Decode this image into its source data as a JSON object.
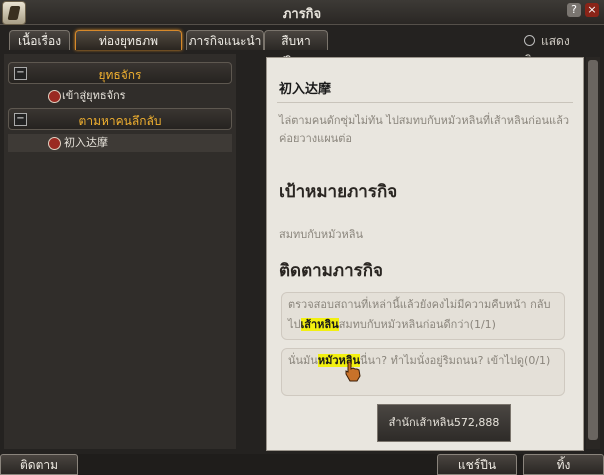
{
  "window": {
    "title": "ภารกิจ"
  },
  "tabs": [
    {
      "label": "เนื้อเรื่อง"
    },
    {
      "label": "ท่องยุทธภพ"
    },
    {
      "label": "ภารกิจแนะนำ"
    },
    {
      "label": "สืบหาปริศนา"
    }
  ],
  "show_toggle": {
    "label": "แสดงติดตาม"
  },
  "quest_list": {
    "groups": [
      {
        "label": "ยุทธจักร",
        "items": [
          "เข้าสู่ยุทธจักร"
        ]
      },
      {
        "label": "ตามหาคนลึกลับ",
        "items": [
          "初入达摩"
        ]
      }
    ]
  },
  "detail": {
    "quest_title": "初入达摩",
    "description": "ไล่ตามคนดักซุ่มไม่ทัน ไปสมทบกับหมัวหลินที่เส้าหลินก่อนแล้วค่อยวางแผนต่อ",
    "goal_heading": "เป้าหมายภารกิจ",
    "goal_text": "สมทบกับหมัวหลิน",
    "track_heading": "ติดตามภารกิจ",
    "track1_a": "ตรวจสอบสถานที่เหล่านี้แล้วยังคงไม่มีความคืบหน้า กลับไป",
    "track1_hl": "เส้าหลิน",
    "track1_b": "สมทบกับหมัวหลินก่อนดีกว่า(1/1)",
    "track2_a": "นั่นมัน",
    "track2_hl": "หมัวหลิน",
    "track2_b": "นี่นา? ทำไมนั่งอยู่ริมถนน? เข้าไปดู(0/1)",
    "reward": "สำนักเส้าหลิน572,888"
  },
  "footer": {
    "track_btn": "ติดตาม",
    "share_btn": "แชร์ปืน",
    "abandon_btn": "ทิ้ง"
  }
}
